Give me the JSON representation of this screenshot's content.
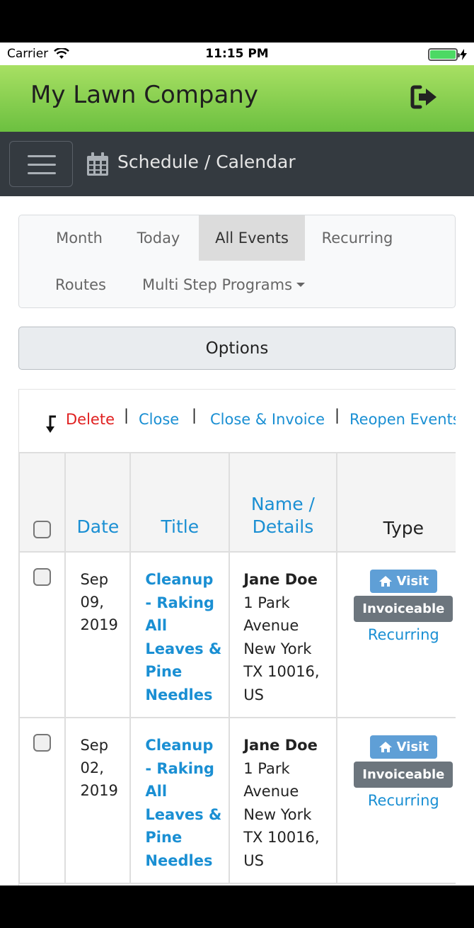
{
  "status_bar": {
    "carrier": "Carrier",
    "time": "11:15 PM"
  },
  "app": {
    "title": "My Lawn Company"
  },
  "navbar": {
    "title": "Schedule / Calendar"
  },
  "tabs": [
    {
      "label": "Month"
    },
    {
      "label": "Today"
    },
    {
      "label": "All Events",
      "active": true
    },
    {
      "label": "Recurring"
    },
    {
      "label": "Routes"
    },
    {
      "label": "Multi Step Programs"
    }
  ],
  "options_label": "Options",
  "actions": {
    "delete": "Delete",
    "close": "Close",
    "close_invoice": "Close & Invoice",
    "reopen": "Reopen Events",
    "separator": "|"
  },
  "table": {
    "headers": {
      "date": "Date",
      "title": "Title",
      "name_line1": "Name /",
      "name_line2": "Details",
      "type": "Type"
    },
    "rows": [
      {
        "date": [
          "Sep",
          "09,",
          "2019"
        ],
        "title": [
          "Cleanup",
          "- Raking",
          "All",
          "Leaves &",
          "Pine",
          "Needles"
        ],
        "name": "Jane Doe",
        "address": [
          "1 Park",
          "Avenue",
          "New York",
          "TX 10016,",
          "US"
        ],
        "badge_visit": "Visit",
        "badge_invoiceable": "Invoiceable",
        "recurring": "Recurring"
      },
      {
        "date": [
          "Sep",
          "02,",
          "2019"
        ],
        "title": [
          "Cleanup",
          "- Raking",
          "All",
          "Leaves &",
          "Pine",
          "Needles"
        ],
        "name": "Jane Doe",
        "address": [
          "1 Park",
          "Avenue",
          "New York",
          "TX 10016,",
          "US"
        ],
        "badge_visit": "Visit",
        "badge_invoiceable": "Invoiceable",
        "recurring": "Recurring"
      }
    ]
  },
  "colors": {
    "link": "#1a8fd3",
    "delete": "#e02020",
    "navbar": "#343a40",
    "appbar_top": "#a8e063",
    "appbar_bottom": "#6cc040"
  }
}
